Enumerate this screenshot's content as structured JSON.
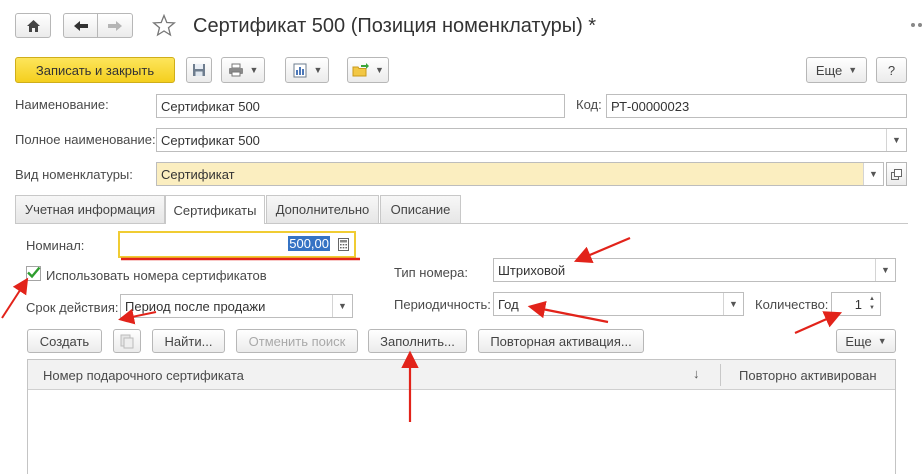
{
  "window": {
    "title": "Сертификат 500 (Позиция номенклатуры) *"
  },
  "toolbar": {
    "save_close_label": "Записать и закрыть",
    "more_label": "Еще",
    "help_label": "?"
  },
  "form": {
    "name_label": "Наименование:",
    "name_value": "Сертификат 500",
    "code_label": "Код:",
    "code_value": "РТ-00000023",
    "full_name_label": "Полное наименование:",
    "full_name_value": "Сертификат 500",
    "kind_label": "Вид номенклатуры:",
    "kind_value": "Сертификат"
  },
  "tabs": [
    {
      "label": "Учетная информация"
    },
    {
      "label": "Сертификаты"
    },
    {
      "label": "Дополнительно"
    },
    {
      "label": "Описание"
    }
  ],
  "certificates": {
    "nominal_label": "Номинал:",
    "nominal_value": "500,00",
    "use_numbers_label": "Использовать номера сертификатов",
    "use_numbers_checked": true,
    "validity_label": "Срок действия:",
    "validity_value": "Период после продажи",
    "number_type_label": "Тип номера:",
    "number_type_value": "Штриховой",
    "periodicity_label": "Периодичность:",
    "periodicity_value": "Год",
    "quantity_label": "Количество:",
    "quantity_value": "1",
    "buttons": {
      "create": "Создать",
      "find": "Найти...",
      "cancel_search": "Отменить поиск",
      "fill": "Заполнить...",
      "reactivation": "Повторная активация...",
      "more": "Еще"
    },
    "table": {
      "columns": [
        "Номер подарочного сертификата",
        "Повторно активирован"
      ],
      "sort_glyph": "↓"
    }
  },
  "colors": {
    "accent_yellow": "#f5d327",
    "highlight_field": "#fbeec0",
    "annotation_red": "#e2231a",
    "selection_blue": "#3573c4"
  }
}
